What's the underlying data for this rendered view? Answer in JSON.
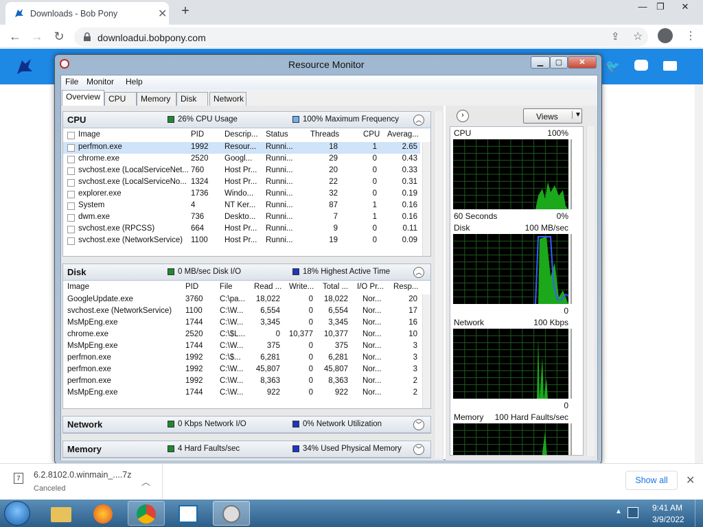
{
  "browser": {
    "tab_title": "Downloads - Bob Pony",
    "url": "downloadui.bobpony.com"
  },
  "rm": {
    "title": "Resource Monitor",
    "menu": [
      "File",
      "Monitor",
      "Help"
    ],
    "tabs": [
      "Overview",
      "CPU",
      "Memory",
      "Disk",
      "Network"
    ],
    "cpu": {
      "title": "CPU",
      "stat1": "26% CPU Usage",
      "stat2": "100% Maximum Frequency",
      "columns": [
        "Image",
        "PID",
        "Descrip...",
        "Status",
        "Threads",
        "CPU",
        "Averag..."
      ],
      "rows": [
        [
          "perfmon.exe",
          "1992",
          "Resour...",
          "Runni...",
          "18",
          "1",
          "2.65"
        ],
        [
          "chrome.exe",
          "2520",
          "Googl...",
          "Runni...",
          "29",
          "0",
          "0.43"
        ],
        [
          "svchost.exe (LocalServiceNet...",
          "760",
          "Host Pr...",
          "Runni...",
          "20",
          "0",
          "0.33"
        ],
        [
          "svchost.exe (LocalServiceNo...",
          "1324",
          "Host Pr...",
          "Runni...",
          "22",
          "0",
          "0.31"
        ],
        [
          "explorer.exe",
          "1736",
          "Windo...",
          "Runni...",
          "32",
          "0",
          "0.19"
        ],
        [
          "System",
          "4",
          "NT Ker...",
          "Runni...",
          "87",
          "1",
          "0.16"
        ],
        [
          "dwm.exe",
          "736",
          "Deskto...",
          "Runni...",
          "7",
          "1",
          "0.16"
        ],
        [
          "svchost.exe (RPCSS)",
          "664",
          "Host Pr...",
          "Runni...",
          "9",
          "0",
          "0.11"
        ],
        [
          "svchost.exe (NetworkService)",
          "1100",
          "Host Pr...",
          "Runni...",
          "19",
          "0",
          "0.09"
        ]
      ]
    },
    "disk": {
      "title": "Disk",
      "stat1": "0 MB/sec Disk I/O",
      "stat2": "18% Highest Active Time",
      "columns": [
        "Image",
        "PID",
        "File",
        "Read ...",
        "Write...",
        "Total ...",
        "I/O Pr...",
        "Resp..."
      ],
      "rows": [
        [
          "GoogleUpdate.exe",
          "3760",
          "C:\\pa...",
          "18,022",
          "0",
          "18,022",
          "Nor...",
          "20"
        ],
        [
          "svchost.exe (NetworkService)",
          "1100",
          "C:\\W...",
          "6,554",
          "0",
          "6,554",
          "Nor...",
          "17"
        ],
        [
          "MsMpEng.exe",
          "1744",
          "C:\\W...",
          "3,345",
          "0",
          "3,345",
          "Nor...",
          "16"
        ],
        [
          "chrome.exe",
          "2520",
          "C:\\$L...",
          "0",
          "10,377",
          "10,377",
          "Nor...",
          "10"
        ],
        [
          "MsMpEng.exe",
          "1744",
          "C:\\W...",
          "375",
          "0",
          "375",
          "Nor...",
          "3"
        ],
        [
          "perfmon.exe",
          "1992",
          "C:\\$...",
          "6,281",
          "0",
          "6,281",
          "Nor...",
          "3"
        ],
        [
          "perfmon.exe",
          "1992",
          "C:\\W...",
          "45,807",
          "0",
          "45,807",
          "Nor...",
          "3"
        ],
        [
          "perfmon.exe",
          "1992",
          "C:\\W...",
          "8,363",
          "0",
          "8,363",
          "Nor...",
          "2"
        ],
        [
          "MsMpEng.exe",
          "1744",
          "C:\\W...",
          "922",
          "0",
          "922",
          "Nor...",
          "2"
        ]
      ]
    },
    "network": {
      "title": "Network",
      "stat1": "0 Kbps Network I/O",
      "stat2": "0% Network Utilization"
    },
    "memory": {
      "title": "Memory",
      "stat1": "4 Hard Faults/sec",
      "stat2": "34% Used Physical Memory"
    },
    "right": {
      "views_label": "Views",
      "graphs": [
        {
          "name": "CPU",
          "max": "100%",
          "foot_left": "60 Seconds",
          "foot_right": "0%"
        },
        {
          "name": "Disk",
          "max": "100 MB/sec",
          "foot_left": "",
          "foot_right": "0"
        },
        {
          "name": "Network",
          "max": "100 Kbps",
          "foot_left": "",
          "foot_right": "0"
        },
        {
          "name": "Memory",
          "max": "100 Hard Faults/sec",
          "foot_left": "",
          "foot_right": ""
        }
      ]
    }
  },
  "download": {
    "filename": "6.2.8102.0.winmain_....7z",
    "status": "Canceled",
    "show_all": "Show all"
  },
  "taskbar": {
    "time": "9:41 AM",
    "date": "3/9/2022"
  }
}
